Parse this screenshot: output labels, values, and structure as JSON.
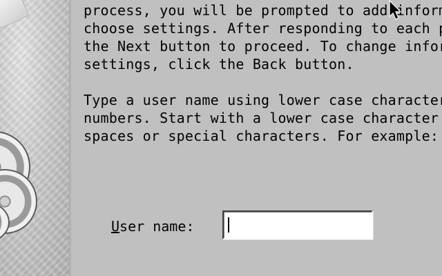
{
  "instructions": {
    "paragraph_1": [
      "process, you will be prompted to add inform",
      "choose settings. After responding to each pr",
      "the Next button to proceed. To change inform",
      "settings, click the Back button."
    ],
    "paragraph_2": [
      "Type a user name using lower case character",
      "numbers. Start with a lower case character a",
      "spaces or special characters. For example: m"
    ]
  },
  "form": {
    "username_label_mnemonic": "U",
    "username_label_rest": "ser name:",
    "username_value": "",
    "username_placeholder": ""
  },
  "icons": {
    "pointer": "mouse-pointer-icon",
    "side_graphic": "cd-discs-graphic"
  },
  "colors": {
    "background": "#c0c0c0",
    "input_background": "#ffffff",
    "text": "#000000"
  }
}
